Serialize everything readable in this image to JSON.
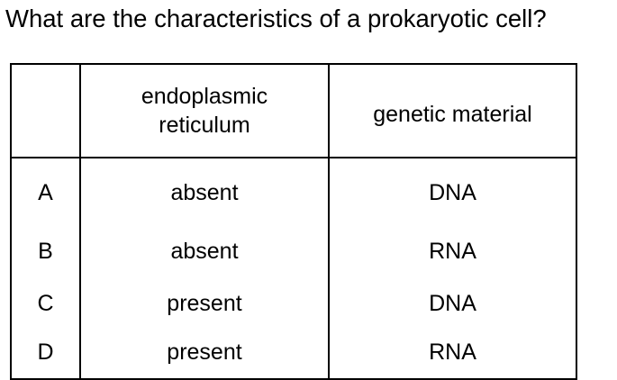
{
  "question": "What are the characteristics of a prokaryotic cell?",
  "table": {
    "headers": {
      "option": "",
      "er_line1": "endoplasmic",
      "er_line2": "reticulum",
      "genetic_material": "genetic material"
    },
    "rows": [
      {
        "option": "A",
        "er": "absent",
        "genetic_material": "DNA"
      },
      {
        "option": "B",
        "er": "absent",
        "genetic_material": "RNA"
      },
      {
        "option": "C",
        "er": "present",
        "genetic_material": "DNA"
      },
      {
        "option": "D",
        "er": "present",
        "genetic_material": "RNA"
      }
    ]
  }
}
